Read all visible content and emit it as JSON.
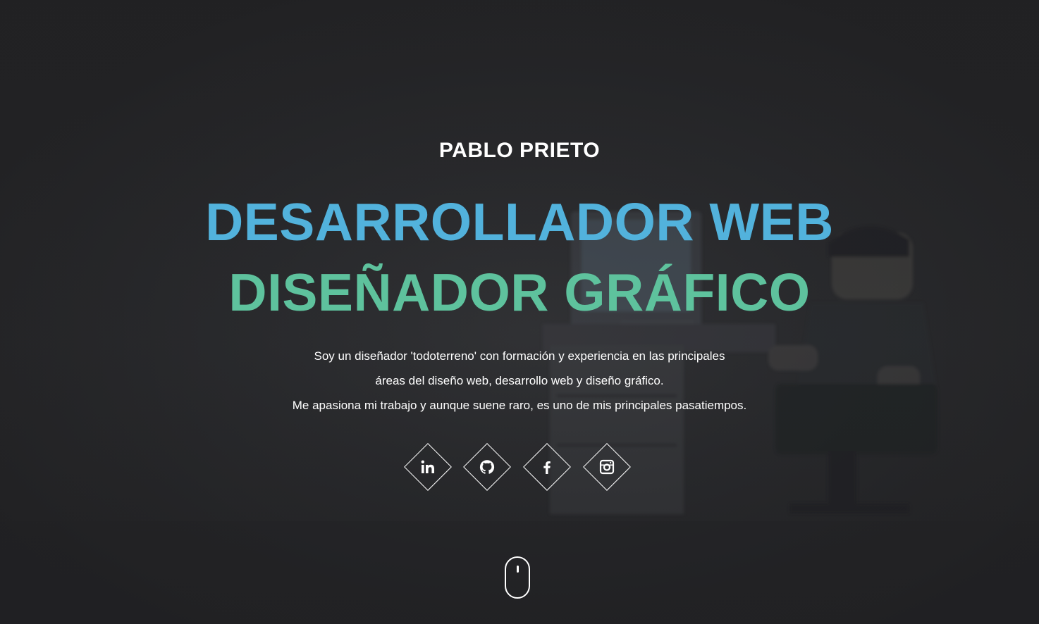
{
  "hero": {
    "name": "PABLO PRIETO",
    "title_line_1": "DESARROLLADOR WEB",
    "title_line_2": "DISEÑADOR GRÁFICO",
    "description": [
      "Soy un diseñador 'todoterreno' con formación y experiencia en las principales",
      "áreas del diseño web, desarrollo web y diseño gráfico.",
      "Me apasiona mi trabajo y aunque suene raro, es uno de mis principales pasatiempos."
    ]
  },
  "socials": [
    {
      "icon": "linkedin-icon"
    },
    {
      "icon": "github-icon"
    },
    {
      "icon": "facebook-icon"
    },
    {
      "icon": "instagram-icon"
    }
  ],
  "scroll_indicator": {
    "icon": "mouse-scroll-icon"
  },
  "colors": {
    "background": "#262628",
    "text": "#ffffff",
    "title_1": "#52b2dc",
    "title_2": "#5ec29d"
  }
}
